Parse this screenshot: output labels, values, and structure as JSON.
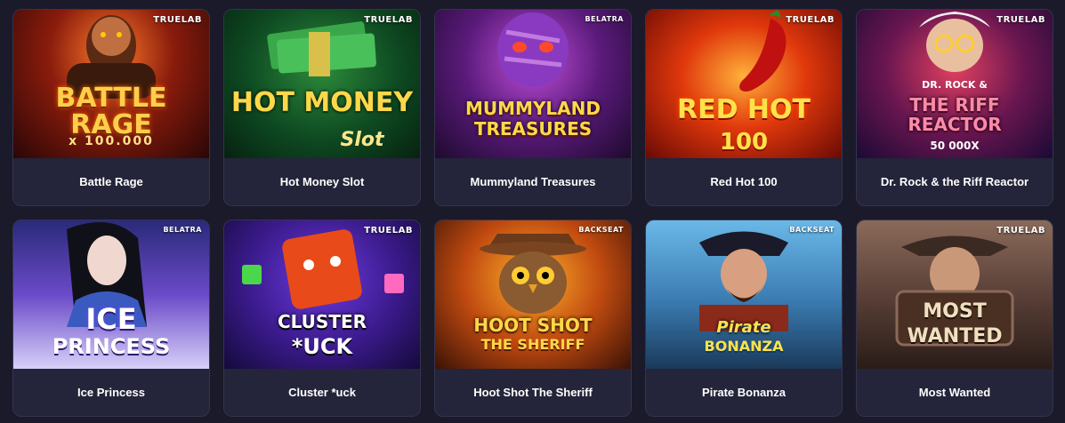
{
  "games": [
    {
      "name": "Battle Rage",
      "provider": "TRUELAB",
      "art_title": "BATTLE RAGE",
      "art_sub": "x 100.000"
    },
    {
      "name": "Hot Money Slot",
      "provider": "TRUELAB",
      "art_title": "HOT MONEY",
      "art_sub": "Slot"
    },
    {
      "name": "Mummyland Treasures",
      "provider": "BELATRA",
      "art_title": "MUMMYLAND TREASURES",
      "art_sub": ""
    },
    {
      "name": "Red Hot 100",
      "provider": "TRUELAB",
      "art_title": "RED HOT",
      "art_sub": "100"
    },
    {
      "name": "Dr. Rock & the Riff Reactor",
      "provider": "TRUELAB",
      "art_title": "THE RIFF REACTOR",
      "art_sub": "50 000X",
      "art_pre": "DR. ROCK &"
    },
    {
      "name": "Ice Princess",
      "provider": "BELATRA",
      "art_title": "ICE",
      "art_sub": "PRINCESS"
    },
    {
      "name": "Cluster *uck",
      "provider": "TRUELAB",
      "art_title": "CLUSTER",
      "art_sub": "*UCK"
    },
    {
      "name": "Hoot Shot The Sheriff",
      "provider": "BACKSEAT",
      "art_title": "HOOT SHOT",
      "art_sub": "THE SHERIFF"
    },
    {
      "name": "Pirate Bonanza",
      "provider": "BACKSEAT",
      "art_title": "Pirate",
      "art_sub": "BONANZA"
    },
    {
      "name": "Most Wanted",
      "provider": "TRUELAB",
      "art_title": "MOST",
      "art_sub": "WANTED"
    }
  ],
  "colors": {
    "page_bg": "#1a1a2a",
    "card_bg": "#24243a",
    "caption_text": "#ffffff"
  }
}
